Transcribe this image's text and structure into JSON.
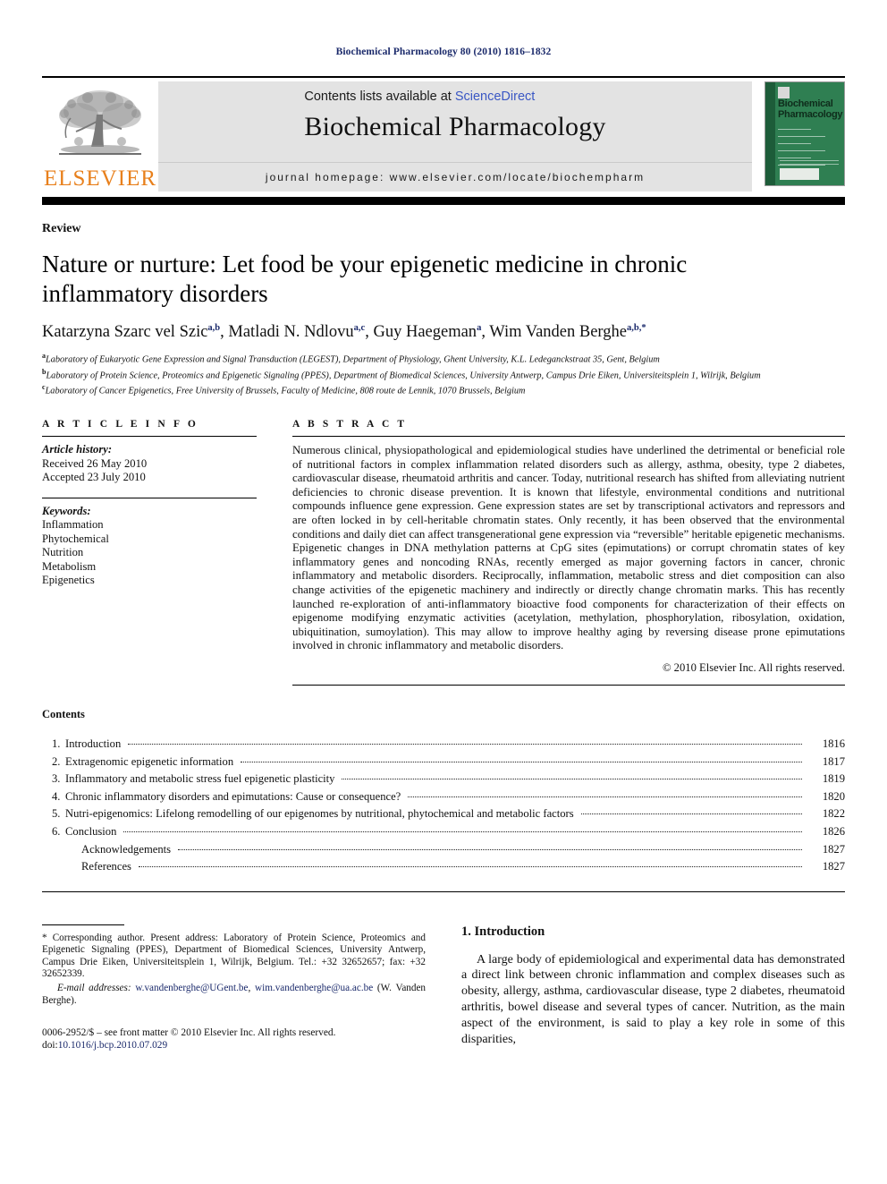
{
  "running_head": "Biochemical Pharmacology 80 (2010) 1816–1832",
  "masthead": {
    "contents_prefix": "Contents lists available at ",
    "sciencedirect": "ScienceDirect",
    "journal_name": "Biochemical Pharmacology",
    "homepage": "journal homepage: www.elsevier.com/locate/biochempharm",
    "publisher_logo_text": "ELSEVIER",
    "cover_title": "Biochemical Pharmacology",
    "accent_orange": "#e8801c",
    "accent_link_blue": "#3a57c4",
    "cover_green": "#2f7f52"
  },
  "article": {
    "type_label": "Review",
    "title": "Nature or nurture: Let food be your epigenetic medicine in chronic inflammatory disorders",
    "authors": "Katarzyna Szarc vel Szic a,b, Matladi N. Ndlovu a,c, Guy Haegeman a, Wim Vanden Berghe a,b,*",
    "authors_parts": [
      {
        "name": "Katarzyna Szarc vel Szic",
        "sup": "a,b"
      },
      {
        "name": "Matladi N. Ndlovu",
        "sup": "a,c"
      },
      {
        "name": "Guy Haegeman",
        "sup": "a"
      },
      {
        "name": "Wim Vanden Berghe",
        "sup": "a,b,*"
      }
    ],
    "affiliations": [
      {
        "mark": "a",
        "text": "Laboratory of Eukaryotic Gene Expression and Signal Transduction (LEGEST), Department of Physiology, Ghent University, K.L. Ledeganckstraat 35, Gent, Belgium"
      },
      {
        "mark": "b",
        "text": "Laboratory of Protein Science, Proteomics and Epigenetic Signaling (PPES), Department of Biomedical Sciences, University Antwerp, Campus Drie Eiken, Universiteitsplein 1, Wilrijk, Belgium"
      },
      {
        "mark": "c",
        "text": "Laboratory of Cancer Epigenetics, Free University of Brussels, Faculty of Medicine, 808 route de Lennik, 1070 Brussels, Belgium"
      }
    ]
  },
  "article_info": {
    "heading": "A R T I C L E   I N F O",
    "history_label": "Article history:",
    "received": "Received 26 May 2010",
    "accepted": "Accepted 23 July 2010",
    "keywords_label": "Keywords:",
    "keywords": [
      "Inflammation",
      "Phytochemical",
      "Nutrition",
      "Metabolism",
      "Epigenetics"
    ]
  },
  "abstract": {
    "heading": "A B S T R A C T",
    "body": "Numerous clinical, physiopathological and epidemiological studies have underlined the detrimental or beneficial role of nutritional factors in complex inflammation related disorders such as allergy, asthma, obesity, type 2 diabetes, cardiovascular disease, rheumatoid arthritis and cancer. Today, nutritional research has shifted from alleviating nutrient deficiencies to chronic disease prevention. It is known that lifestyle, environmental conditions and nutritional compounds influence gene expression. Gene expression states are set by transcriptional activators and repressors and are often locked in by cell-heritable chromatin states. Only recently, it has been observed that the environmental conditions and daily diet can affect transgenerational gene expression via “reversible” heritable epigenetic mechanisms. Epigenetic changes in DNA methylation patterns at CpG sites (epimutations) or corrupt chromatin states of key inflammatory genes and noncoding RNAs, recently emerged as major governing factors in cancer, chronic inflammatory and metabolic disorders. Reciprocally, inflammation, metabolic stress and diet composition can also change activities of the epigenetic machinery and indirectly or directly change chromatin marks. This has recently launched re-exploration of anti-inflammatory bioactive food components for characterization of their effects on epigenome modifying enzymatic activities (acetylation, methylation, phosphorylation, ribosylation, oxidation, ubiquitination, sumoylation). This may allow to improve healthy aging by reversing disease prone epimutations involved in chronic inflammatory and metabolic disorders.",
    "copyright": "© 2010 Elsevier Inc. All rights reserved."
  },
  "contents": {
    "title": "Contents",
    "rows": [
      {
        "num": "1.",
        "label": "Introduction",
        "page": "1816"
      },
      {
        "num": "2.",
        "label": "Extragenomic epigenetic information",
        "page": "1817"
      },
      {
        "num": "3.",
        "label": "Inflammatory and metabolic stress fuel epigenetic plasticity",
        "page": "1819"
      },
      {
        "num": "4.",
        "label": "Chronic inflammatory disorders and epimutations: Cause or consequence?",
        "page": "1820"
      },
      {
        "num": "5.",
        "label": "Nutri-epigenomics: Lifelong remodelling of our epigenomes by nutritional, phytochemical and metabolic factors",
        "page": "1822"
      },
      {
        "num": "6.",
        "label": "Conclusion",
        "page": "1826"
      },
      {
        "num": "",
        "label": "Acknowledgements",
        "page": "1827"
      },
      {
        "num": "",
        "label": "References",
        "page": "1827"
      }
    ]
  },
  "footnotes": {
    "corresponding": "* Corresponding author. Present address: Laboratory of Protein Science, Proteomics and Epigenetic Signaling (PPES), Department of Biomedical Sciences, University Antwerp, Campus Drie Eiken, Universiteitsplein 1, Wilrijk, Belgium. Tel.: +32 32652657; fax: +32 32652339.",
    "email_label": "E-mail addresses:",
    "email_1": "w.vandenberghe@UGent.be",
    "email_sep": ", ",
    "email_2": "wim.vandenberghe@ua.ac.be",
    "email_owner": "(W. Vanden Berghe).",
    "front_matter": "0006-2952/$ – see front matter © 2010 Elsevier Inc. All rights reserved.",
    "doi_label": "doi:",
    "doi_value": "10.1016/j.bcp.2010.07.029"
  },
  "introduction": {
    "heading": "1.  Introduction",
    "paragraph": "A large body of epidemiological and experimental data has demonstrated a direct link between chronic inflammation and complex diseases such as obesity, allergy, asthma, cardiovascular disease, type 2 diabetes, rheumatoid arthritis, bowel disease and several types of cancer. Nutrition, as the main aspect of the environment, is said to play a key role in some of this disparities,"
  }
}
